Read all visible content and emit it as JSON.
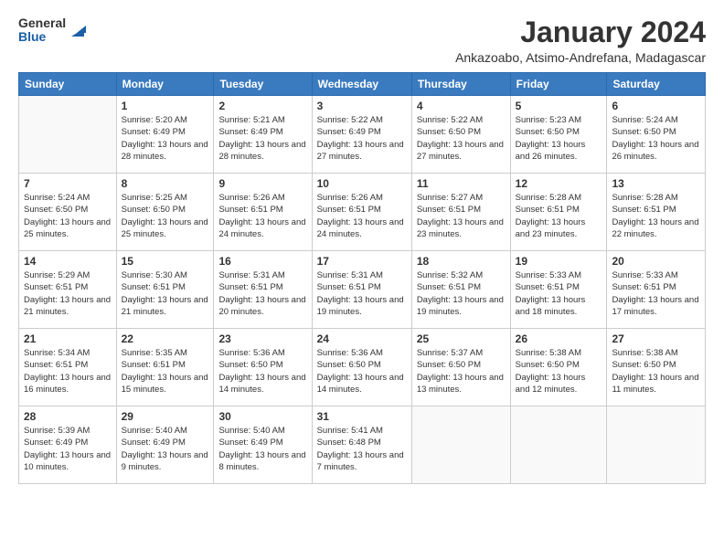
{
  "logo": {
    "line1": "General",
    "line2": "Blue"
  },
  "title": "January 2024",
  "subtitle": "Ankazoabo, Atsimo-Andrefana, Madagascar",
  "weekdays": [
    "Sunday",
    "Monday",
    "Tuesday",
    "Wednesday",
    "Thursday",
    "Friday",
    "Saturday"
  ],
  "weeks": [
    [
      {
        "day": "",
        "info": ""
      },
      {
        "day": "1",
        "info": "Sunrise: 5:20 AM\nSunset: 6:49 PM\nDaylight: 13 hours\nand 28 minutes."
      },
      {
        "day": "2",
        "info": "Sunrise: 5:21 AM\nSunset: 6:49 PM\nDaylight: 13 hours\nand 28 minutes."
      },
      {
        "day": "3",
        "info": "Sunrise: 5:22 AM\nSunset: 6:49 PM\nDaylight: 13 hours\nand 27 minutes."
      },
      {
        "day": "4",
        "info": "Sunrise: 5:22 AM\nSunset: 6:50 PM\nDaylight: 13 hours\nand 27 minutes."
      },
      {
        "day": "5",
        "info": "Sunrise: 5:23 AM\nSunset: 6:50 PM\nDaylight: 13 hours\nand 26 minutes."
      },
      {
        "day": "6",
        "info": "Sunrise: 5:24 AM\nSunset: 6:50 PM\nDaylight: 13 hours\nand 26 minutes."
      }
    ],
    [
      {
        "day": "7",
        "info": "Sunrise: 5:24 AM\nSunset: 6:50 PM\nDaylight: 13 hours\nand 25 minutes."
      },
      {
        "day": "8",
        "info": "Sunrise: 5:25 AM\nSunset: 6:50 PM\nDaylight: 13 hours\nand 25 minutes."
      },
      {
        "day": "9",
        "info": "Sunrise: 5:26 AM\nSunset: 6:51 PM\nDaylight: 13 hours\nand 24 minutes."
      },
      {
        "day": "10",
        "info": "Sunrise: 5:26 AM\nSunset: 6:51 PM\nDaylight: 13 hours\nand 24 minutes."
      },
      {
        "day": "11",
        "info": "Sunrise: 5:27 AM\nSunset: 6:51 PM\nDaylight: 13 hours\nand 23 minutes."
      },
      {
        "day": "12",
        "info": "Sunrise: 5:28 AM\nSunset: 6:51 PM\nDaylight: 13 hours\nand 23 minutes."
      },
      {
        "day": "13",
        "info": "Sunrise: 5:28 AM\nSunset: 6:51 PM\nDaylight: 13 hours\nand 22 minutes."
      }
    ],
    [
      {
        "day": "14",
        "info": "Sunrise: 5:29 AM\nSunset: 6:51 PM\nDaylight: 13 hours\nand 21 minutes."
      },
      {
        "day": "15",
        "info": "Sunrise: 5:30 AM\nSunset: 6:51 PM\nDaylight: 13 hours\nand 21 minutes."
      },
      {
        "day": "16",
        "info": "Sunrise: 5:31 AM\nSunset: 6:51 PM\nDaylight: 13 hours\nand 20 minutes."
      },
      {
        "day": "17",
        "info": "Sunrise: 5:31 AM\nSunset: 6:51 PM\nDaylight: 13 hours\nand 19 minutes."
      },
      {
        "day": "18",
        "info": "Sunrise: 5:32 AM\nSunset: 6:51 PM\nDaylight: 13 hours\nand 19 minutes."
      },
      {
        "day": "19",
        "info": "Sunrise: 5:33 AM\nSunset: 6:51 PM\nDaylight: 13 hours\nand 18 minutes."
      },
      {
        "day": "20",
        "info": "Sunrise: 5:33 AM\nSunset: 6:51 PM\nDaylight: 13 hours\nand 17 minutes."
      }
    ],
    [
      {
        "day": "21",
        "info": "Sunrise: 5:34 AM\nSunset: 6:51 PM\nDaylight: 13 hours\nand 16 minutes."
      },
      {
        "day": "22",
        "info": "Sunrise: 5:35 AM\nSunset: 6:51 PM\nDaylight: 13 hours\nand 15 minutes."
      },
      {
        "day": "23",
        "info": "Sunrise: 5:36 AM\nSunset: 6:50 PM\nDaylight: 13 hours\nand 14 minutes."
      },
      {
        "day": "24",
        "info": "Sunrise: 5:36 AM\nSunset: 6:50 PM\nDaylight: 13 hours\nand 14 minutes."
      },
      {
        "day": "25",
        "info": "Sunrise: 5:37 AM\nSunset: 6:50 PM\nDaylight: 13 hours\nand 13 minutes."
      },
      {
        "day": "26",
        "info": "Sunrise: 5:38 AM\nSunset: 6:50 PM\nDaylight: 13 hours\nand 12 minutes."
      },
      {
        "day": "27",
        "info": "Sunrise: 5:38 AM\nSunset: 6:50 PM\nDaylight: 13 hours\nand 11 minutes."
      }
    ],
    [
      {
        "day": "28",
        "info": "Sunrise: 5:39 AM\nSunset: 6:49 PM\nDaylight: 13 hours\nand 10 minutes."
      },
      {
        "day": "29",
        "info": "Sunrise: 5:40 AM\nSunset: 6:49 PM\nDaylight: 13 hours\nand 9 minutes."
      },
      {
        "day": "30",
        "info": "Sunrise: 5:40 AM\nSunset: 6:49 PM\nDaylight: 13 hours\nand 8 minutes."
      },
      {
        "day": "31",
        "info": "Sunrise: 5:41 AM\nSunset: 6:48 PM\nDaylight: 13 hours\nand 7 minutes."
      },
      {
        "day": "",
        "info": ""
      },
      {
        "day": "",
        "info": ""
      },
      {
        "day": "",
        "info": ""
      }
    ]
  ]
}
